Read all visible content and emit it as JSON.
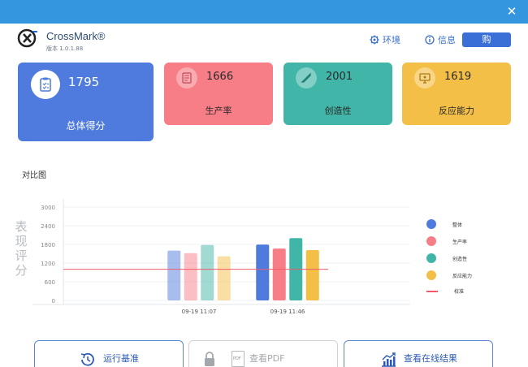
{
  "app": {
    "name": "CrossMark®",
    "version": "版本 1.0.1.88",
    "close_icon": "close-icon"
  },
  "header": {
    "env_label": "环境",
    "info_label": "信息",
    "buy_label": "购",
    "icons": [
      "gear-icon",
      "info-icon"
    ]
  },
  "cards": {
    "overall": {
      "score": "1795",
      "label": "总体得分",
      "icon": "clipboard-icon",
      "color": "#4f7bde"
    },
    "productivity": {
      "score": "1666",
      "label": "生产率",
      "icon": "document-icon",
      "color": "#f77e87"
    },
    "creativity": {
      "score": "2001",
      "label": "创造性",
      "icon": "brush-icon",
      "color": "#41b5a8"
    },
    "responsiveness": {
      "score": "1619",
      "label": "反应能力",
      "icon": "monitor-icon",
      "color": "#f4bf47"
    }
  },
  "comparison": {
    "title": "对比图",
    "y_axis_title": "表现评分"
  },
  "chart_data": {
    "type": "bar",
    "categories": [
      "09-19 11:07",
      "09-19 11:46"
    ],
    "series": [
      {
        "name": "整体",
        "values": [
          1600,
          1795
        ],
        "color": "#4f7bde"
      },
      {
        "name": "生产率",
        "values": [
          1520,
          1666
        ],
        "color": "#f77e87"
      },
      {
        "name": "创造性",
        "values": [
          1780,
          2001
        ],
        "color": "#41b5a8"
      },
      {
        "name": "反应能力",
        "values": [
          1420,
          1619
        ],
        "color": "#f4bf47"
      }
    ],
    "faded_categories": [
      0
    ],
    "baseline": {
      "name": "校准",
      "value": 1000,
      "color": "#f05a6a"
    },
    "y_ticks": [
      0,
      600,
      1200,
      1800,
      2400,
      3000
    ],
    "ylim": [
      0,
      3000
    ],
    "grid": true,
    "legend_position": "right"
  },
  "buttons": {
    "run": {
      "label": "运行基准",
      "icon": "clock-icon"
    },
    "pdf": {
      "label": "查看PDF",
      "icon": "lock-icon",
      "sub_icon": "pdf-file-icon",
      "badge": "PDF",
      "enabled": false
    },
    "online": {
      "label": "查看在线结果",
      "icon": "chart-up-icon"
    }
  }
}
